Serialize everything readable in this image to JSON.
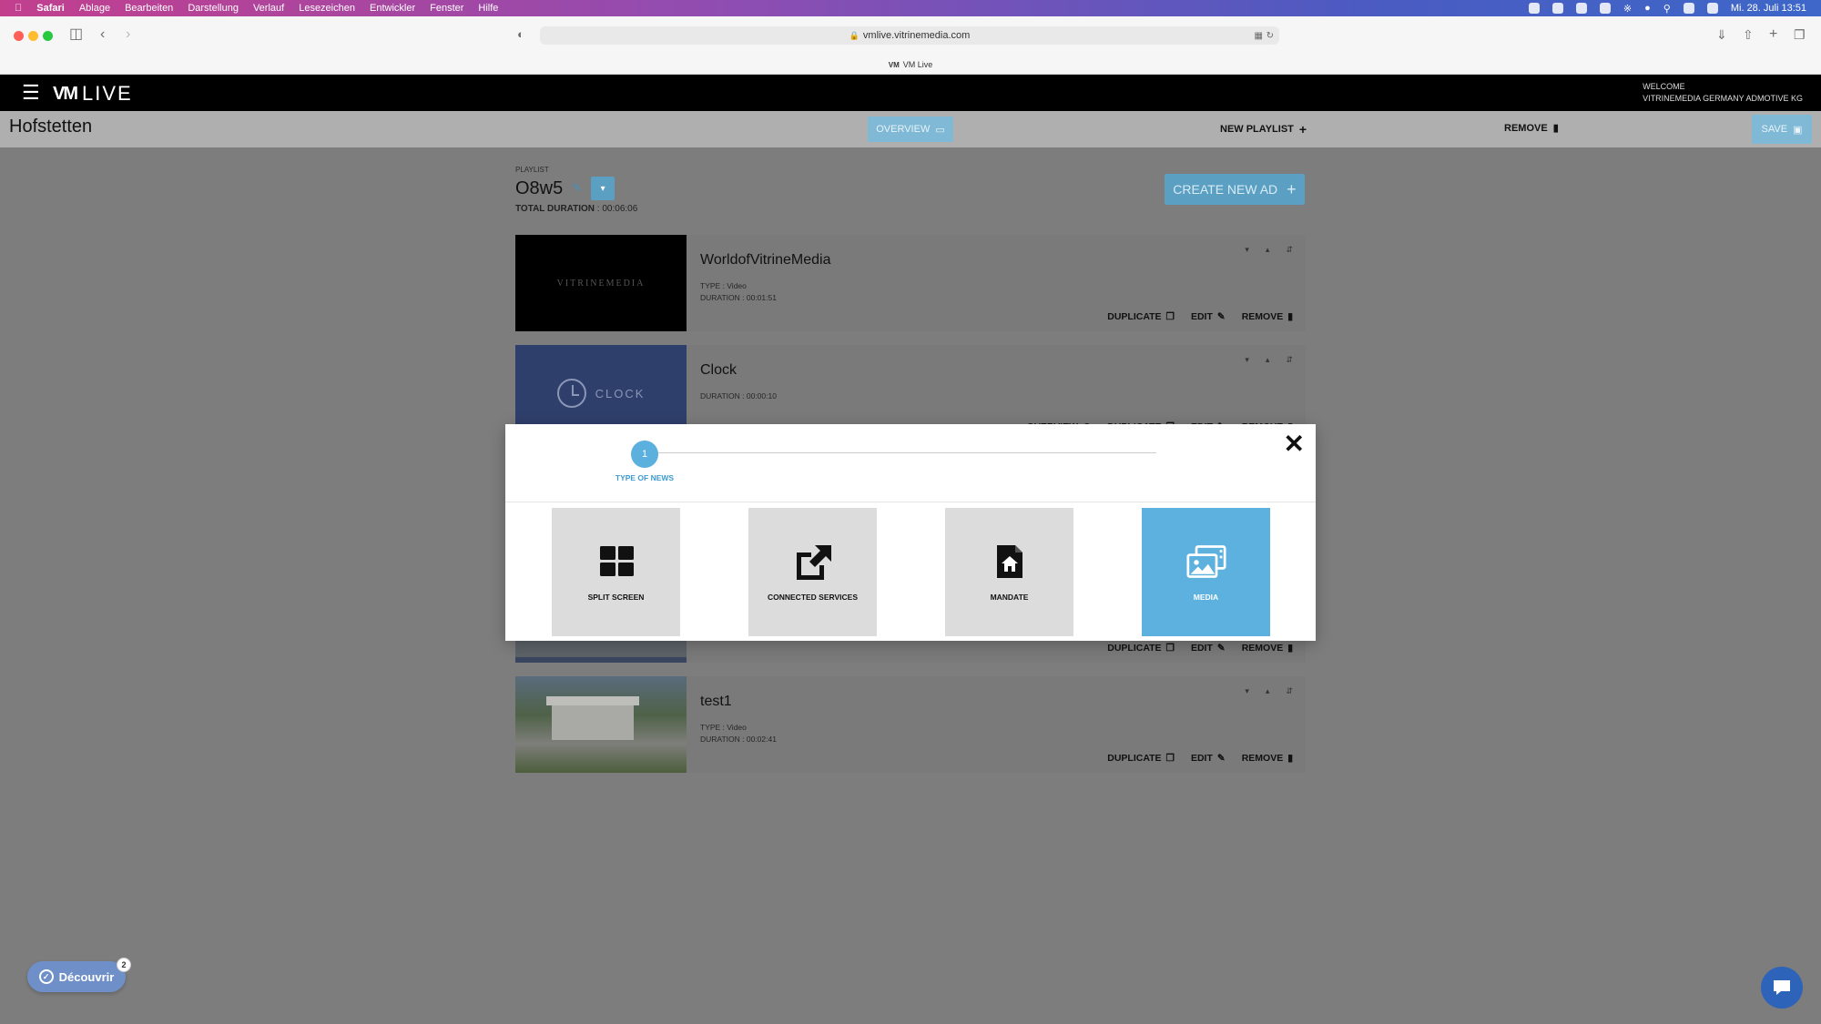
{
  "menubar": {
    "app": "Safari",
    "items": [
      "Ablage",
      "Bearbeiten",
      "Darstellung",
      "Verlauf",
      "Lesezeichen",
      "Entwickler",
      "Fenster",
      "Hilfe"
    ],
    "clock": "Mi. 28. Juli  13:51"
  },
  "browser": {
    "url": "vmlive.vitrinemedia.com",
    "tab_title": "VM Live"
  },
  "app_header": {
    "logo_mark": "VM",
    "logo_text": "LIVE",
    "welcome_label": "WELCOME",
    "welcome_name": "VITRINEMEDIA GERMANY ADMOTIVE KG"
  },
  "subbar": {
    "location": "Hofstetten",
    "overview_label": "OVERVIEW",
    "new_playlist_label": "NEW PLAYLIST",
    "remove_label": "REMOVE",
    "save_label": "SAVE"
  },
  "playlist": {
    "small_label": "PLAYLIST",
    "name": "O8w5",
    "total_duration_label": "TOTAL DURATION",
    "total_duration_value": "00:06:06",
    "create_label": "CREATE NEW AD"
  },
  "ads": [
    {
      "title": "WorldofVitrineMedia",
      "type_line": "TYPE : Video",
      "duration_line": "DURATION : 00:01:51",
      "thumb_text": "VITRINEMEDIA",
      "actions": [
        "DUPLICATE",
        "EDIT",
        "REMOVE"
      ]
    },
    {
      "title": "Clock",
      "duration_line": "DURATION : 00:00:10",
      "thumb_text": "CLOCK",
      "actions": [
        "OVERVIEW",
        "DUPLICATE",
        "EDIT",
        "REMOVE"
      ]
    },
    {
      "actions": [
        "DUPLICATE",
        "EDIT",
        "REMOVE"
      ]
    },
    {
      "title": "test1",
      "type_line": "TYPE : Video",
      "duration_line": "DURATION : 00:02:41",
      "actions": [
        "DUPLICATE",
        "EDIT",
        "REMOVE"
      ]
    }
  ],
  "modal": {
    "step_number": "1",
    "step_label": "TYPE OF NEWS",
    "types": [
      {
        "label": "SPLIT SCREEN",
        "icon": "grid-icon"
      },
      {
        "label": "CONNECTED SERVICES",
        "icon": "external-link-icon"
      },
      {
        "label": "MANDATE",
        "icon": "house-document-icon"
      },
      {
        "label": "MEDIA",
        "icon": "images-icon",
        "selected": true
      }
    ]
  },
  "widgets": {
    "decouvrir_label": "Découvrir",
    "decouvrir_badge": "2"
  },
  "colors": {
    "accent": "#5db1de",
    "header_bg": "#000000",
    "overlay": "#7d7d7d"
  }
}
